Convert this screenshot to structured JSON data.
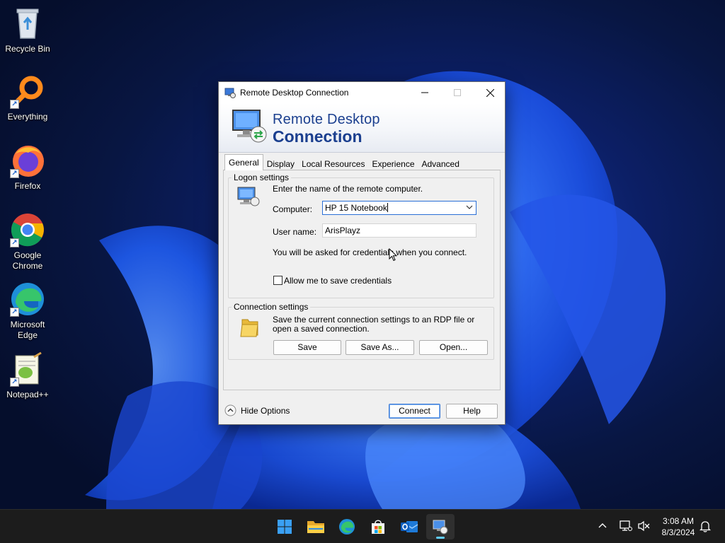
{
  "desktop": {
    "icons": [
      {
        "label": "Recycle Bin"
      },
      {
        "label": "Everything"
      },
      {
        "label": "Firefox"
      },
      {
        "label": "Google Chrome"
      },
      {
        "label": "Microsoft Edge"
      },
      {
        "label": "Notepad++"
      }
    ]
  },
  "window": {
    "title": "Remote Desktop Connection",
    "banner_line1": "Remote Desktop",
    "banner_line2": "Connection",
    "tabs": [
      "General",
      "Display",
      "Local Resources",
      "Experience",
      "Advanced"
    ],
    "active_tab": "General",
    "logon": {
      "legend": "Logon settings",
      "instruction": "Enter the name of the remote computer.",
      "computer_label": "Computer:",
      "computer_value": "HP 15 Notebook",
      "username_label": "User name:",
      "username_value": "ArisPlayz",
      "credentials_note": "You will be asked for credentials when you connect.",
      "save_credentials_label": "Allow me to save credentials",
      "save_credentials_checked": false
    },
    "connection": {
      "legend": "Connection settings",
      "description": "Save the current connection settings to an RDP file or open a saved connection.",
      "save_label": "Save",
      "save_as_label": "Save As...",
      "open_label": "Open..."
    },
    "footer": {
      "hide_options_label": "Hide Options",
      "connect_label": "Connect",
      "help_label": "Help"
    }
  },
  "taskbar": {
    "apps": [
      "start-icon",
      "file-explorer-icon",
      "edge-icon",
      "store-icon",
      "outlook-icon",
      "remote-desktop-icon"
    ],
    "time": "3:08 AM",
    "date": "8/3/2024"
  },
  "colors": {
    "banner_text": "#1b3f8f",
    "focus_border": "#2a6fd6",
    "taskbar_bg": "#1c1c1c",
    "active_indicator": "#60cdff"
  }
}
